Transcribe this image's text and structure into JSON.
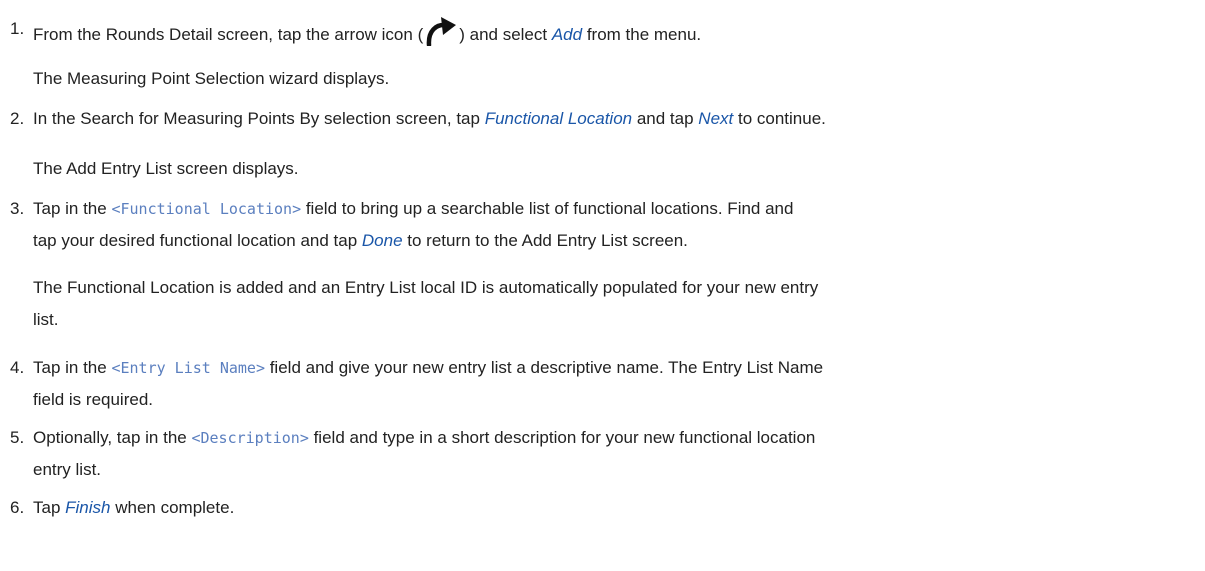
{
  "steps": [
    {
      "number": "1.",
      "pre": "From the Rounds Detail screen, tap the arrow icon (",
      "icon": "curved-arrow-icon",
      "mid": ") and select ",
      "ui": "Add",
      "post": " from the menu.",
      "result": "The Measuring Point Selection wizard displays."
    },
    {
      "number": "2.",
      "pre": "In the Search for Measuring Points By selection screen, tap ",
      "ui1": "Functional Location",
      "mid": " and tap ",
      "ui2": "Next",
      "post": " to continue.",
      "result": "The Add Entry List screen displays."
    },
    {
      "number": "3.",
      "pre": "Tap in the ",
      "code": "<Functional Location>",
      "post_line1": " field to bring up a searchable list of functional locations. Find and",
      "line2_pre": "tap your desired functional location and tap ",
      "ui": "Done",
      "line2_post": " to return to the Add Entry List screen.",
      "result_line1": "The Functional Location is added and an Entry List local ID is automatically populated for your new entry",
      "result_line2": "list."
    },
    {
      "number": "4.",
      "pre": "Tap in the ",
      "code": "<Entry List Name>",
      "post_line1": " field and give your new entry list a descriptive name. The Entry List Name",
      "line2": "field is required."
    },
    {
      "number": "5.",
      "pre": "Optionally, tap in the ",
      "code": "<Description>",
      "post_line1": " field and type in a short description for your new functional location",
      "line2": "entry list."
    },
    {
      "number": "6.",
      "pre": "Tap ",
      "ui": "Finish",
      "post": " when complete."
    }
  ]
}
